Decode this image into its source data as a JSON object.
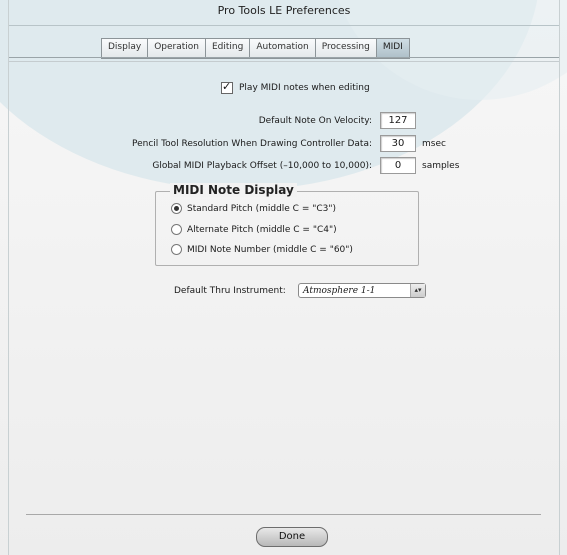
{
  "window": {
    "title": "Pro Tools LE Preferences"
  },
  "tabs": [
    {
      "label": "Display"
    },
    {
      "label": "Operation"
    },
    {
      "label": "Editing"
    },
    {
      "label": "Automation"
    },
    {
      "label": "Processing"
    },
    {
      "label": "MIDI",
      "active": true
    }
  ],
  "play_midi": {
    "label": "Play MIDI notes when editing",
    "checked": true
  },
  "velocity": {
    "label": "Default Note On Velocity:",
    "value": "127"
  },
  "pencil": {
    "label": "Pencil Tool Resolution When Drawing Controller Data:",
    "value": "30",
    "unit": "msec"
  },
  "offset": {
    "label": "Global MIDI Playback Offset (–10,000 to 10,000):",
    "value": "0",
    "unit": "samples"
  },
  "note_display": {
    "title": "MIDI Note Display",
    "options": [
      {
        "label": "Standard Pitch (middle C = \"C3\")",
        "selected": true
      },
      {
        "label": "Alternate Pitch (middle C = \"C4\")",
        "selected": false
      },
      {
        "label": "MIDI Note Number (middle C = \"60\")",
        "selected": false
      }
    ]
  },
  "thru": {
    "label": "Default Thru Instrument:",
    "value": "Atmosphere 1-1"
  },
  "footer": {
    "done_label": "Done"
  }
}
